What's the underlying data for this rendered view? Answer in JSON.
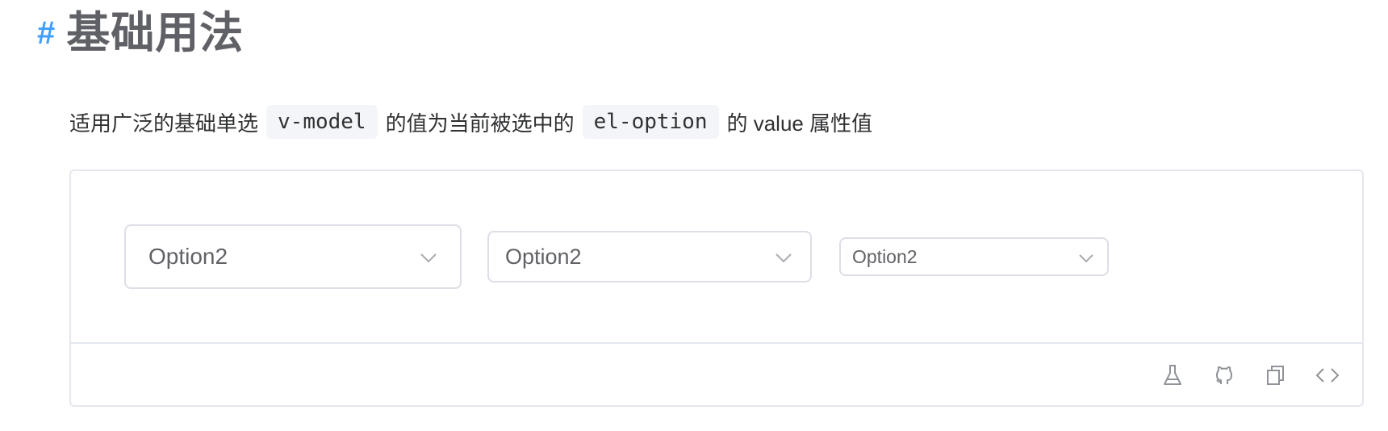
{
  "heading": {
    "hash": "#",
    "title": "基础用法"
  },
  "description": {
    "text_before": "适用广泛的基础单选",
    "code_1": "v-model",
    "text_middle": "的值为当前被选中的",
    "code_2": "el-option",
    "text_after": "的 value 属性值"
  },
  "demo": {
    "selects": [
      {
        "value": "Option2",
        "size": "large",
        "icon": "chevron-down-icon"
      },
      {
        "value": "Option2",
        "size": "default",
        "icon": "chevron-down-icon"
      },
      {
        "value": "Option2",
        "size": "small",
        "icon": "chevron-down-icon"
      }
    ],
    "toolbar": [
      {
        "icon": "flask-icon"
      },
      {
        "icon": "github-icon"
      },
      {
        "icon": "copy-icon"
      },
      {
        "icon": "code-icon"
      }
    ]
  },
  "colors": {
    "accent": "#409eff",
    "border": "#e4e7ed",
    "text": "#303133",
    "muted": "#606266"
  }
}
